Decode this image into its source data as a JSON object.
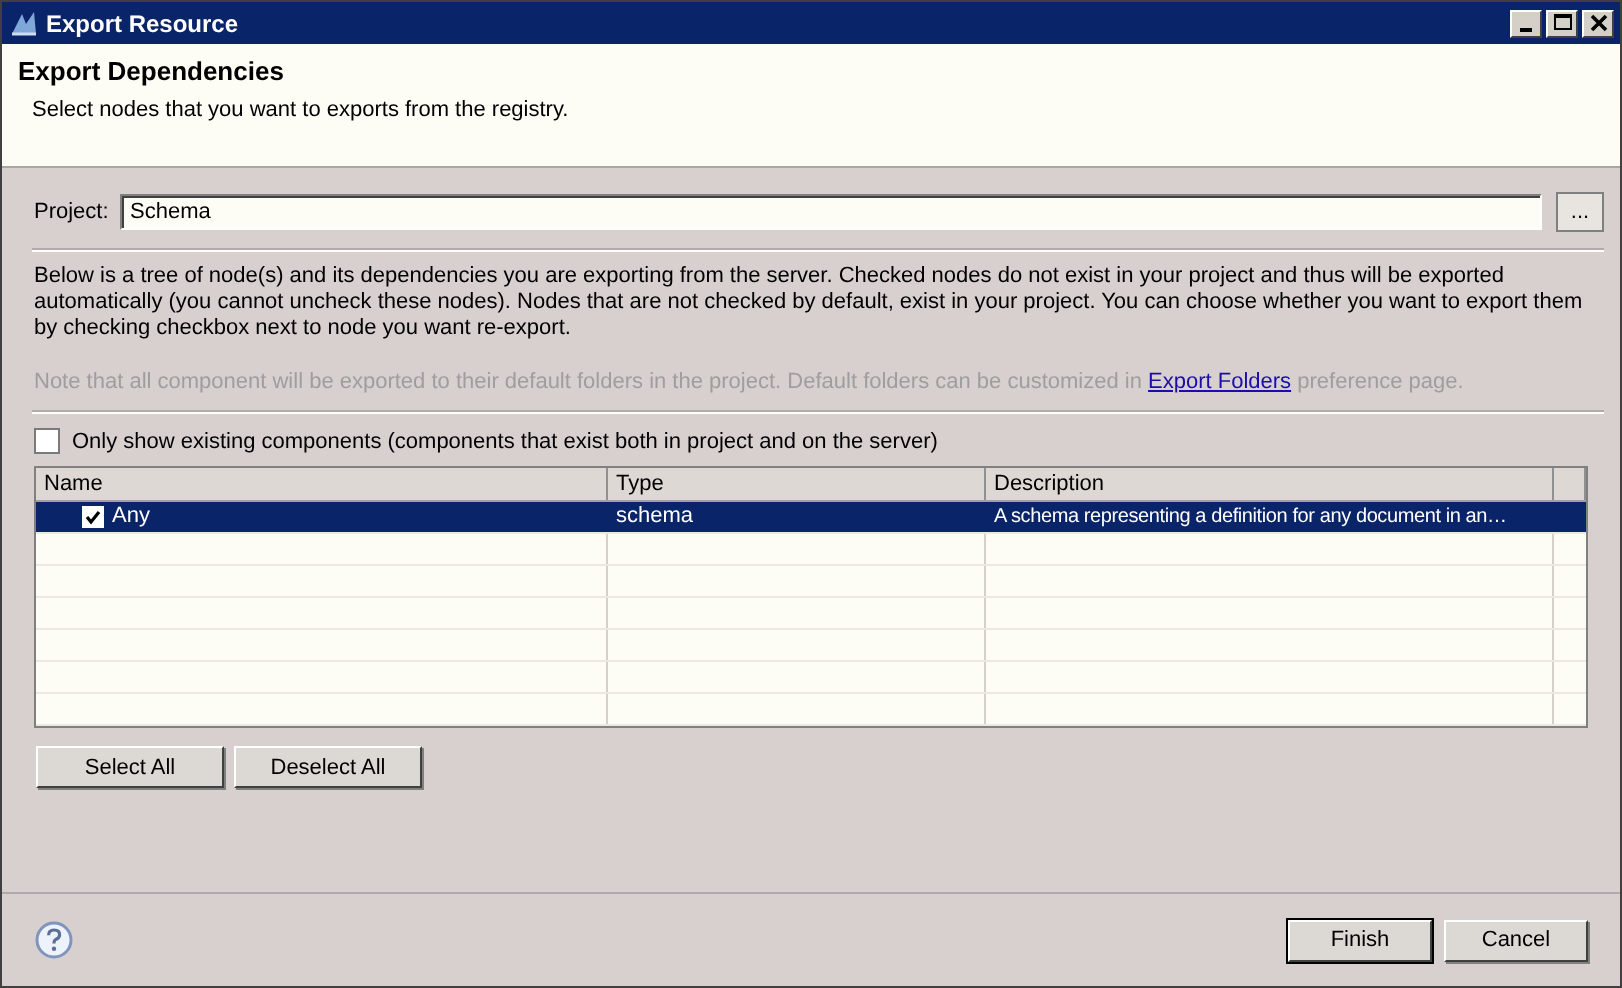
{
  "window": {
    "title": "Export Resource"
  },
  "header": {
    "title": "Export Dependencies",
    "subtitle": "Select nodes that you want to exports from the registry."
  },
  "project": {
    "label": "Project:",
    "value": "Schema",
    "browse_button": "..."
  },
  "description": "Below is a tree of node(s) and its dependencies you are exporting from the server. Checked nodes do not exist in your project and thus will be exported automatically (you cannot uncheck these nodes). Nodes that are not checked by default, exist in your project. You can choose whether you want to export them by checking checkbox next to node you want re-export.",
  "note": {
    "before": "Note that all component will be exported to their default folders in the project. Default folders can be customized in",
    "link": "Export Folders",
    "after": "preference page."
  },
  "filter": {
    "label": "Only show existing components (components that exist both in project and on the server)",
    "checked": false
  },
  "table": {
    "columns": [
      "Name",
      "Type",
      "Description"
    ],
    "rows": [
      {
        "name": "Any",
        "type": "schema",
        "description": "A schema representing a definition for any document in an…",
        "checked": true,
        "selected": true
      }
    ]
  },
  "selection_buttons": [
    "Select All",
    "Deselect All"
  ],
  "footer_buttons": [
    {
      "label": "Finish",
      "default": true
    },
    {
      "label": "Cancel",
      "default": false
    }
  ]
}
